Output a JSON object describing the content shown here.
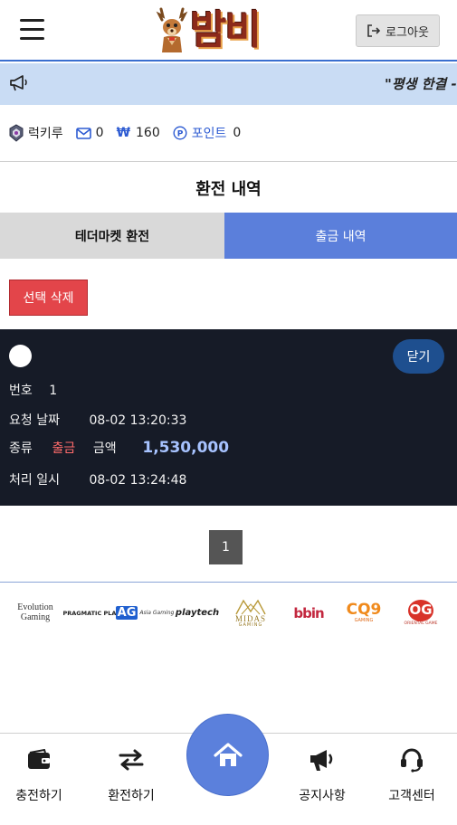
{
  "header": {
    "logo_text": "밤비",
    "logout_label": "로그아웃"
  },
  "marquee": {
    "text": "\"평생 한결 -"
  },
  "userbar": {
    "username": "럭키루",
    "messages": "0",
    "currency_symbol": "₩",
    "balance": "160",
    "point_label": "포인트",
    "points": "0"
  },
  "page": {
    "title": "환전 내역"
  },
  "tabs": [
    {
      "label": "테더마켓 환전"
    },
    {
      "label": "출금 내역"
    }
  ],
  "actions": {
    "delete_selected": "선택 삭제"
  },
  "record": {
    "close_label": "닫기",
    "number_label": "번호",
    "number": "1",
    "request_date_label": "요청 날짜",
    "request_date": "08-02 13:20:33",
    "type_label": "종류",
    "type": "출금",
    "amount_label": "금액",
    "amount": "1,530,000",
    "processed_label": "처리 일시",
    "processed_date": "08-02 13:24:48"
  },
  "pagination": {
    "current_page": "1"
  },
  "providers": [
    {
      "name": "Evolution Gaming",
      "line1": "Evolution",
      "line2": "Gaming"
    },
    {
      "name": "Pragmatic Play",
      "line1": "PRAGMATIC PLAY"
    },
    {
      "name": "Asia Gaming",
      "line1": "AG",
      "line2": "Asia Gaming"
    },
    {
      "name": "Playtech",
      "line1": "playtech"
    },
    {
      "name": "Midas Gaming",
      "line1": "MIDAS",
      "line2": "GAMING"
    },
    {
      "name": "bbin",
      "line1": "bbin"
    },
    {
      "name": "CQ9 Gaming",
      "line1": "CQ9",
      "line2": "GAMING"
    },
    {
      "name": "Oriental Game",
      "line1": "OG",
      "line2": "ORIENTAL GAME"
    }
  ],
  "bottom_nav": [
    {
      "label": "충전하기",
      "icon": "wallet-icon"
    },
    {
      "label": "환전하기",
      "icon": "exchange-arrows-icon"
    },
    {
      "label": "",
      "icon": "home-icon"
    },
    {
      "label": "공지사항",
      "icon": "megaphone-icon"
    },
    {
      "label": "고객센터",
      "icon": "headset-icon"
    }
  ],
  "colors": {
    "accent": "#5b7fdb",
    "marquee_bg": "#c9dcf4",
    "card_bg": "#161b27",
    "delete_red": "#e3454a",
    "withdraw_red": "#ff6b6b",
    "amount_blue": "#a7c3ff"
  }
}
